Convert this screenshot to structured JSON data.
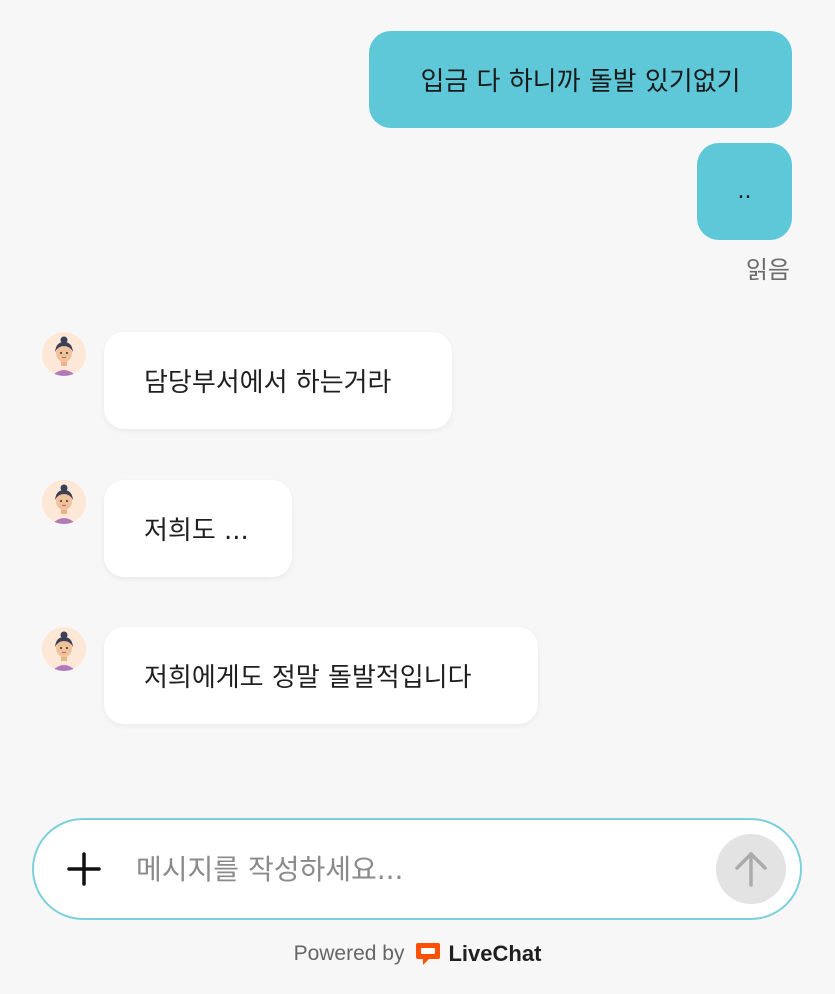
{
  "messages_user": [
    {
      "text": "입금 다 하니까 돌발 있기없기"
    },
    {
      "text": ".."
    }
  ],
  "read_status": "읽음",
  "messages_agent": [
    {
      "text": "담당부서에서 하는거라"
    },
    {
      "text": "저희도 ..."
    },
    {
      "text": "저희에게도 정말 돌발적입니다"
    }
  ],
  "composer": {
    "placeholder": "메시지를 작성하세요...",
    "attach_icon": "plus-icon",
    "send_icon": "arrow-up-icon"
  },
  "footer": {
    "powered_by": "Powered by",
    "brand": "LiveChat",
    "brand_color": "#ff5100"
  },
  "colors": {
    "user_bubble": "#5ec8d8",
    "agent_bubble": "#ffffff",
    "background": "#f7f7f7",
    "composer_border": "#7ccfdc"
  }
}
